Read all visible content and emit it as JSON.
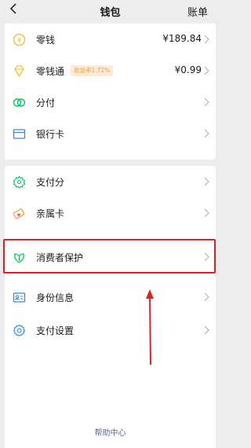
{
  "header": {
    "title": "钱包",
    "bill_label": "账单"
  },
  "wallet_section": {
    "items": [
      {
        "label": "零钱",
        "value": "¥189.84",
        "icon": "coin-icon"
      },
      {
        "label": "零钱通",
        "badge": "收益率1.72%",
        "value": "¥0.99",
        "icon": "diamond-icon"
      },
      {
        "label": "分付",
        "icon": "installment-icon"
      },
      {
        "label": "银行卡",
        "icon": "bank-card-icon"
      }
    ]
  },
  "services_section": {
    "items": [
      {
        "label": "支付分",
        "icon": "score-icon"
      },
      {
        "label": "亲属卡",
        "icon": "family-card-icon"
      },
      {
        "label": "消费者保护",
        "icon": "consumer-protection-icon",
        "highlighted": true
      },
      {
        "label": "身份信息",
        "icon": "id-card-icon"
      },
      {
        "label": "支付设置",
        "icon": "gear-icon"
      }
    ]
  },
  "footer": {
    "help_center": "帮助中心"
  },
  "colors": {
    "accent_green": "#07c160",
    "coin_yellow": "#f5c02c",
    "badge_bg": "#fdebd2",
    "badge_text": "#e3a25a",
    "annotation_red": "#e31f26",
    "link_blue": "#586a8f"
  }
}
